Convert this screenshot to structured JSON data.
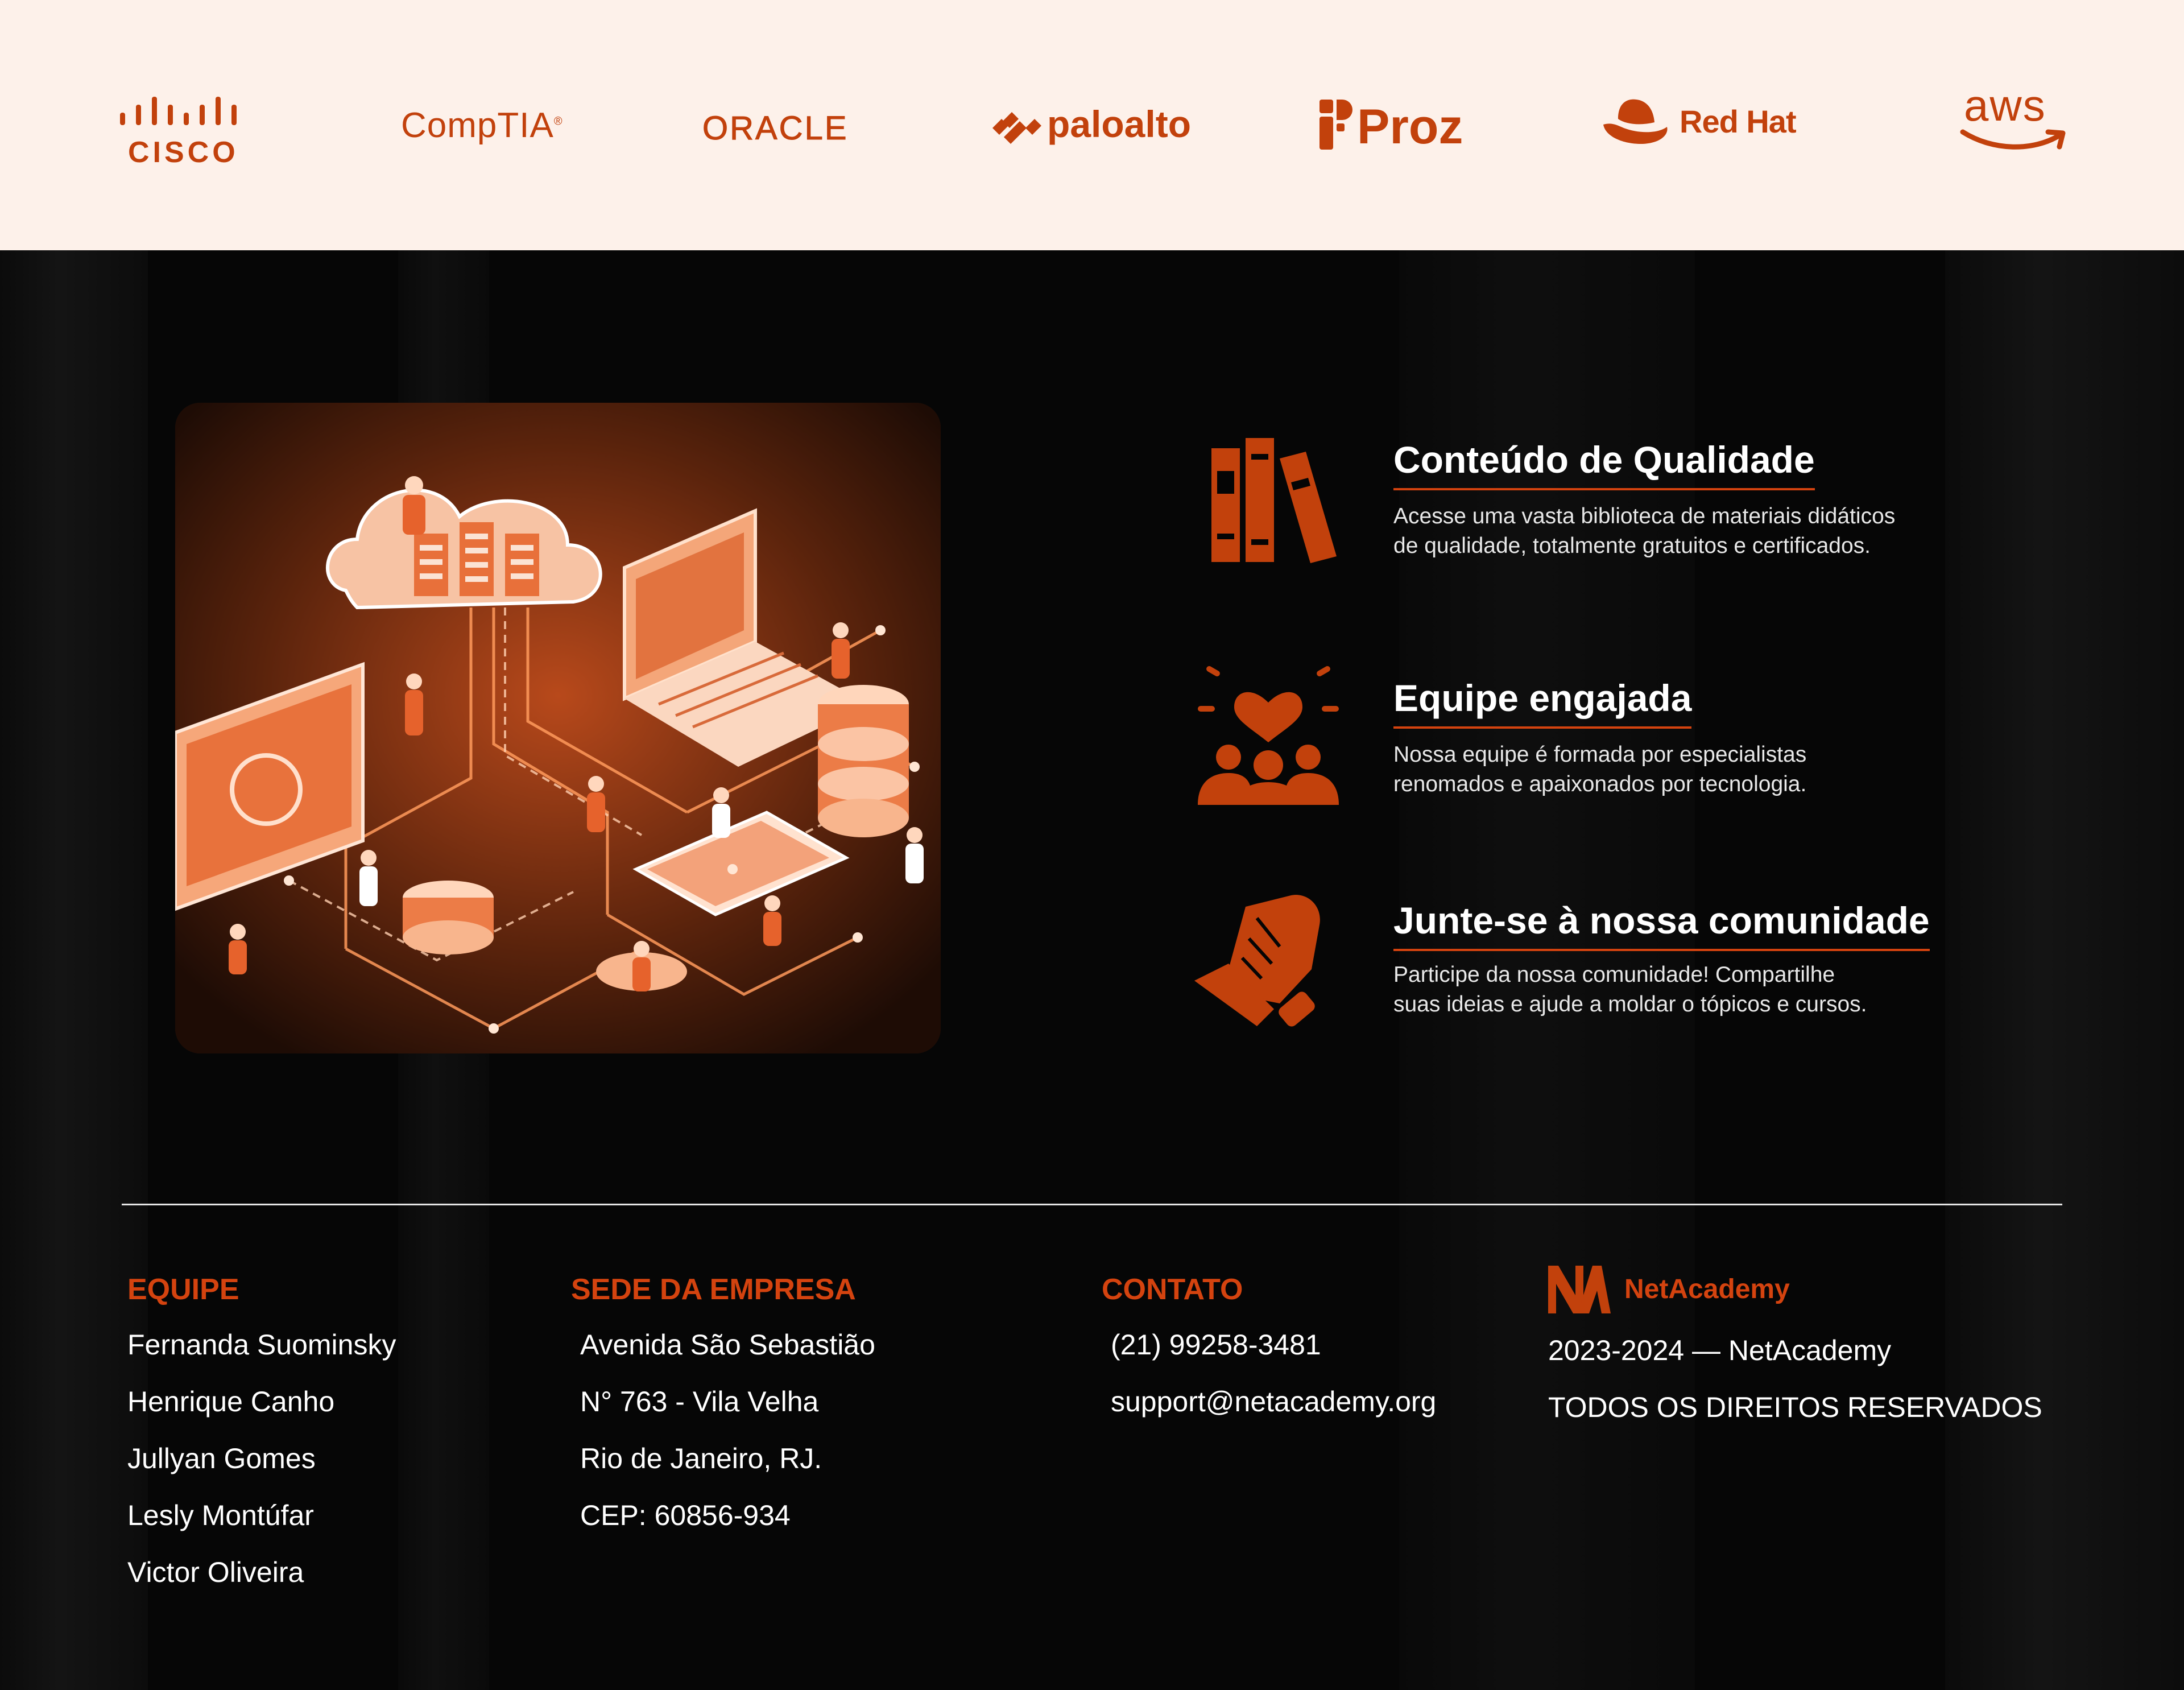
{
  "partners": {
    "cisco": "CISCO",
    "comptia": "CompTIA",
    "oracle": "ORACLE",
    "paloalto": "paloalto",
    "proz": "Proz",
    "redhat": "Red Hat",
    "aws": "aws"
  },
  "features": [
    {
      "icon": "books-icon",
      "title": "Conteúdo de Qualidade",
      "text_line1": "Acesse uma vasta biblioteca de materiais didáticos",
      "text_line2": "de qualidade, totalmente gratuitos e certificados."
    },
    {
      "icon": "team-heart-icon",
      "title": "Equipe engajada",
      "text_line1": "Nossa equipe é formada por especialistas",
      "text_line2": "renomados e apaixonados por tecnologia."
    },
    {
      "icon": "fist-icon",
      "title": "Junte-se à nossa comunidade",
      "text_line1": "Participe da nossa comunidade! Compartilhe",
      "text_line2": "suas ideias e ajude a moldar o tópicos e cursos."
    }
  ],
  "footer": {
    "team": {
      "heading": "EQUIPE",
      "members": [
        "Fernanda Suominsky",
        "Henrique Canho",
        "Jullyan Gomes",
        "Lesly Montúfar",
        "Victor Oliveira"
      ]
    },
    "hq": {
      "heading": "SEDE DA EMPRESA",
      "lines": [
        "Avenida São Sebastião",
        "N° 763 - Vila Velha",
        "Rio de Janeiro, RJ.",
        "CEP: 60856-934"
      ]
    },
    "contact": {
      "heading": "CONTATO",
      "phone": "(21) 99258-3481",
      "email": "support@netacademy.org"
    },
    "brand": {
      "name": "NetAcademy",
      "years": "2023-2024 — NetAcademy",
      "rights": "TODOS OS DIREITOS RESERVADOS"
    }
  },
  "colors": {
    "accent": "#d4430f",
    "logo": "#c2410c",
    "partner_bg": "#fdf1ea",
    "page_bg": "#060606"
  }
}
